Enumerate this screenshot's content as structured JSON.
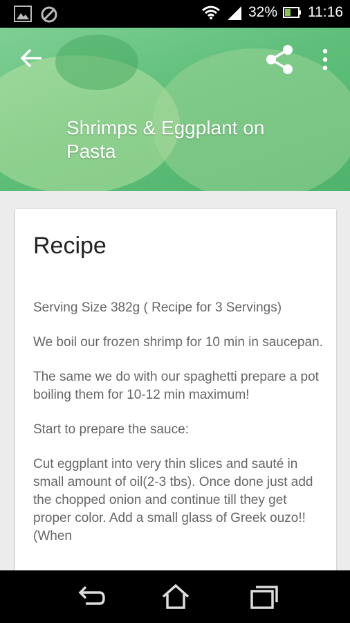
{
  "status_bar": {
    "battery": "32%",
    "time": "11:16"
  },
  "header": {
    "title": "Shrimps & Eggplant on Pasta"
  },
  "recipe": {
    "heading": "Recipe",
    "paragraphs": [
      "Serving Size 382g ( Recipe for 3 Servings)",
      "We boil our frozen shrimp for 10 min in saucepan.",
      "The same we do with our spaghetti prepare a pot boiling them for 10-12 min maximum!",
      "Start to prepare the sauce:",
      "Cut eggplant into very thin slices and sauté  in small amount of  oil(2-3 tbs). Once done just add the chopped onion and continue till they get proper color. Add a small glass of Greek ouzo!! (When"
    ]
  },
  "icons": {
    "back": "arrow-back-icon",
    "share": "share-icon",
    "more": "more-vert-icon",
    "nav_back": "back-icon",
    "nav_home": "home-icon",
    "nav_recents": "recents-icon"
  }
}
